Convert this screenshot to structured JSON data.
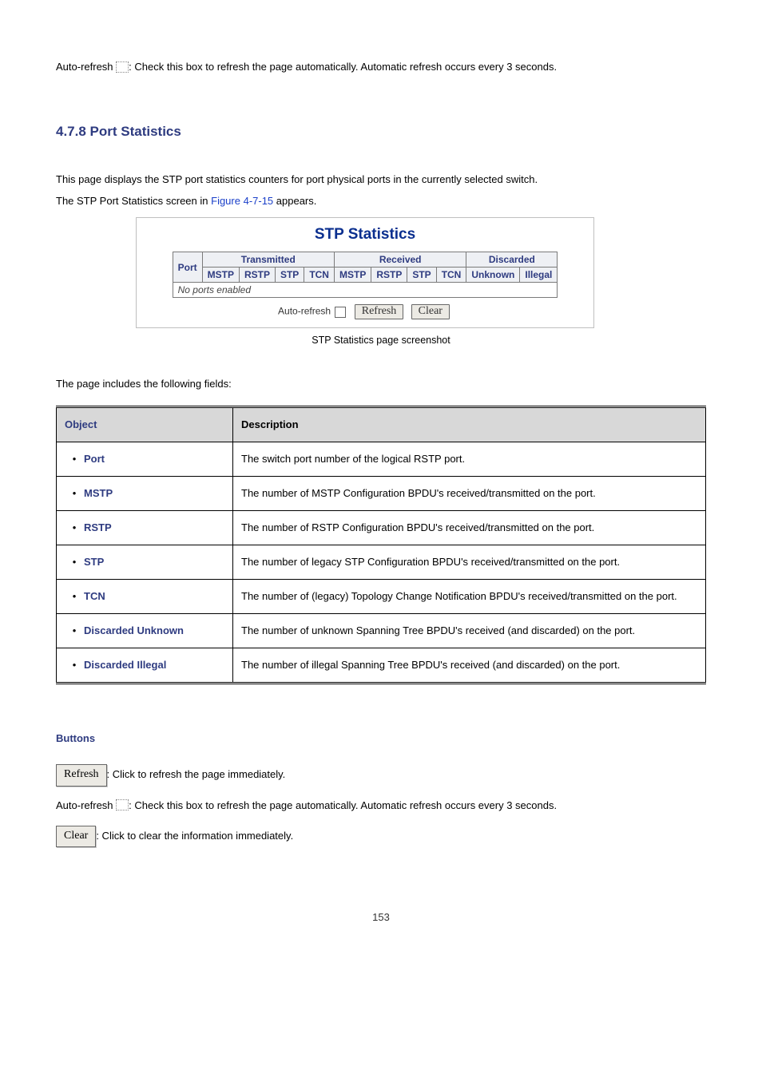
{
  "top_autorefresh": {
    "label": "Auto-refresh ",
    "colon": ": ",
    "text": "Check this box to refresh the page automatically. Automatic refresh occurs every 3 seconds."
  },
  "section_heading": "4.7.8 Port Statistics",
  "intro_1": "This page displays the STP port statistics counters for port physical ports in the currently selected switch.",
  "intro_2a": "The STP Port Statistics screen in ",
  "intro_2link": "Figure 4-7-15",
  "intro_2b": " appears.",
  "figure": {
    "title": "STP Statistics",
    "col_port": "Port",
    "group_tx": "Transmitted",
    "group_rx": "Received",
    "group_disc": "Discarded",
    "cols_tx": [
      "MSTP",
      "RSTP",
      "STP",
      "TCN"
    ],
    "cols_rx": [
      "MSTP",
      "RSTP",
      "STP",
      "TCN"
    ],
    "cols_disc": [
      "Unknown",
      "Illegal"
    ],
    "noports": "No ports enabled",
    "autorefresh_label": "Auto-refresh",
    "refresh_btn": "Refresh",
    "clear_btn": "Clear"
  },
  "caption": "STP Statistics page screenshot",
  "fields_intro": "The page includes the following fields:",
  "fields_header": [
    "Object",
    "Description"
  ],
  "fields": [
    {
      "obj": "Port",
      "desc": "The switch port number of the logical RSTP port."
    },
    {
      "obj": "MSTP",
      "desc": "The number of MSTP Configuration BPDU's received/transmitted on the port."
    },
    {
      "obj": "RSTP",
      "desc": "The number of RSTP Configuration BPDU's received/transmitted on the port."
    },
    {
      "obj": "STP",
      "desc": "The number of legacy STP Configuration BPDU's received/transmitted on the port."
    },
    {
      "obj": "TCN",
      "desc": "The number of (legacy) Topology Change Notification BPDU's received/transmitted on the port."
    },
    {
      "obj": "Discarded Unknown",
      "desc": "The number of unknown Spanning Tree BPDU's received (and discarded) on the port."
    },
    {
      "obj": "Discarded Illegal",
      "desc": "The number of illegal Spanning Tree BPDU's received (and discarded) on the port."
    }
  ],
  "buttons_head": "Buttons",
  "buttons": {
    "refresh_label": "Refresh",
    "refresh_text": ": Click to refresh the page immediately.",
    "autorefresh_label": "Auto-refresh ",
    "autorefresh_colon": ": ",
    "autorefresh_text": "Check this box to refresh the page automatically. Automatic refresh occurs every 3 seconds.",
    "clear_label": "Clear",
    "clear_text": ": Click to clear the information immediately."
  },
  "page_number": "153",
  "chart_data": {
    "type": "table",
    "title": "STP Statistics",
    "column_groups": [
      {
        "name": "Port",
        "columns": [
          "Port"
        ]
      },
      {
        "name": "Transmitted",
        "columns": [
          "MSTP",
          "RSTP",
          "STP",
          "TCN"
        ]
      },
      {
        "name": "Received",
        "columns": [
          "MSTP",
          "RSTP",
          "STP",
          "TCN"
        ]
      },
      {
        "name": "Discarded",
        "columns": [
          "Unknown",
          "Illegal"
        ]
      }
    ],
    "rows": [],
    "empty_message": "No ports enabled"
  }
}
